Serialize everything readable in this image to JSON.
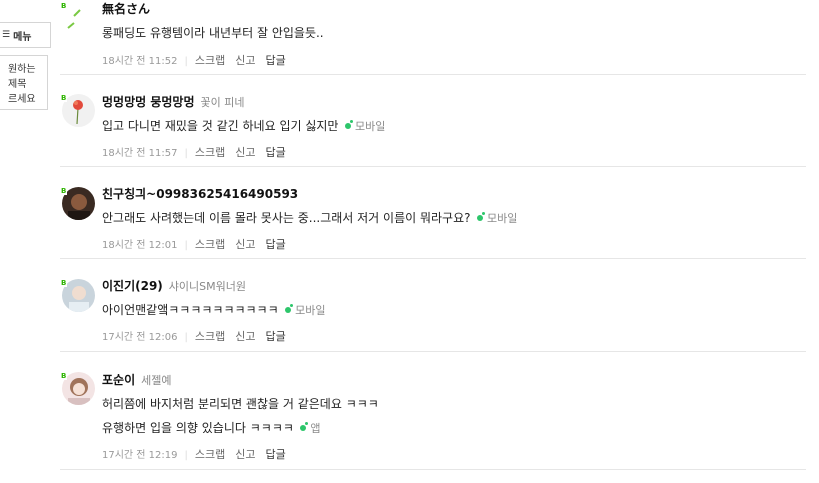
{
  "side_menu": {
    "top_label": "메뉴",
    "box_lines": [
      "원하는",
      "제목",
      "르세요"
    ]
  },
  "actions": {
    "scrap": "스크랩",
    "report": "신고",
    "reply": "답글"
  },
  "comments": [
    {
      "nickname": "無名さん",
      "cafe_name": "",
      "lines": [
        "롱패딩도 유행템이라 내년부터 잘 안입을듯.."
      ],
      "device": "",
      "time": "18시간 전 11:52"
    },
    {
      "nickname": "멍멍망멍 뭉멍망멍",
      "cafe_name": "꽃이 피네",
      "lines": [
        "입고 다니면 재밌을 것 같긴 하네요 입기 싫지만"
      ],
      "device": "모바일",
      "time": "18시간 전 11:57"
    },
    {
      "nickname": "친구칭긔~09983625416490593",
      "cafe_name": "",
      "lines": [
        "안그래도 사려했는데 이름 몰라 못사는 중...그래서 저거 이름이 뭐라구요?"
      ],
      "device": "모바일",
      "time": "18시간 전 12:01"
    },
    {
      "nickname": "이진기(29)",
      "cafe_name": "샤이니SM워너원",
      "lines": [
        "아이언맨같앸ㅋㅋㅋㅋㅋㅋㅋㅋㅋㅋ"
      ],
      "device": "모바일",
      "time": "17시간 전 12:06"
    },
    {
      "nickname": "포순이",
      "cafe_name": "세젤예",
      "lines": [
        "허리쯤에 바지처럼 분리되면 괜찮을 거 같은데요 ㅋㅋㅋ",
        "유행하면 입을 의향 있습니다 ㅋㅋㅋㅋ"
      ],
      "device": "앱",
      "time": "17시간 전 12:19"
    }
  ]
}
